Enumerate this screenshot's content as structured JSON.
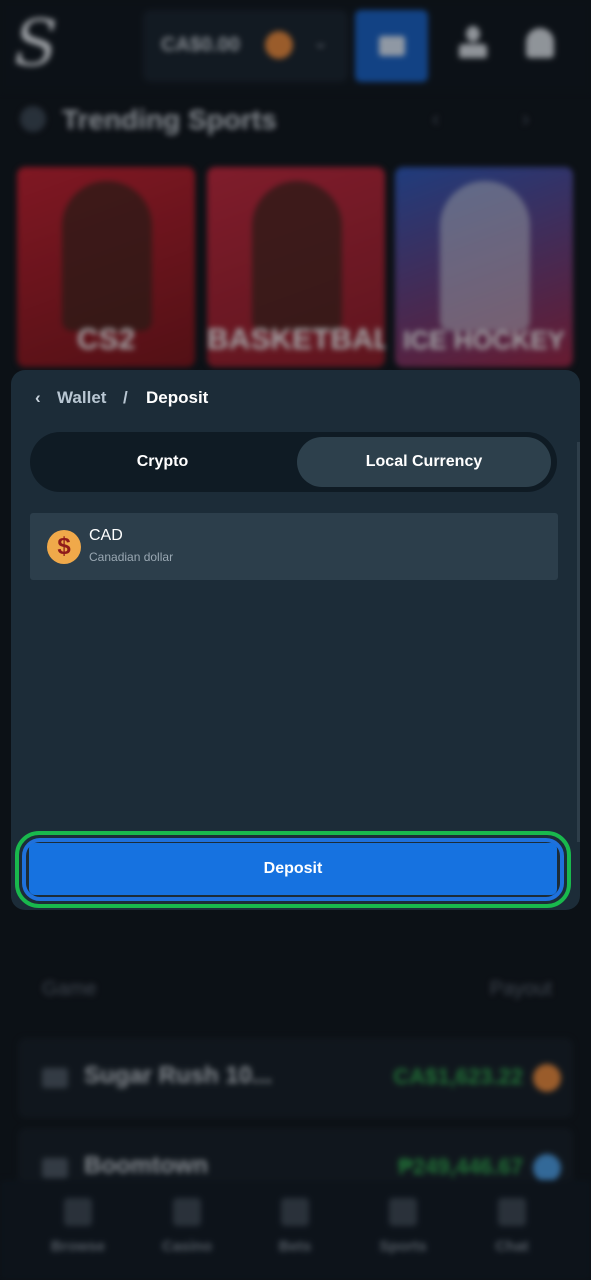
{
  "header": {
    "logo": "S",
    "balance": "CA$0.00",
    "icons": [
      "wallet-icon",
      "user-icon",
      "bell-icon"
    ]
  },
  "trending": {
    "title": "Trending Sports",
    "cards": [
      {
        "label": "CS2"
      },
      {
        "label": "BASKETBALL"
      },
      {
        "label": "ICE HOCKEY"
      }
    ]
  },
  "background_table": {
    "headers": {
      "game": "Game",
      "payout": "Payout"
    },
    "rows": [
      {
        "game": "Sugar Rush 10...",
        "payout": "CA$1,623.22"
      },
      {
        "game": "Boomtown",
        "payout": "₱249,446.67"
      }
    ]
  },
  "bottom_nav": {
    "items": [
      {
        "label": "Browse"
      },
      {
        "label": "Casino"
      },
      {
        "label": "Bets"
      },
      {
        "label": "Sports"
      },
      {
        "label": "Chat"
      }
    ]
  },
  "modal": {
    "breadcrumb": {
      "parent": "Wallet",
      "separator": "/",
      "current": "Deposit"
    },
    "tabs": [
      {
        "label": "Crypto",
        "active": false
      },
      {
        "label": "Local Currency",
        "active": true
      }
    ],
    "currency": {
      "code": "CAD",
      "name": "Canadian dollar",
      "symbol": "$"
    },
    "deposit_button": "Deposit"
  },
  "colors": {
    "accent": "#1672e0",
    "modal_bg": "#1c2c38",
    "highlight_green": "#19b84d",
    "highlight_blue": "#1f71dc"
  }
}
